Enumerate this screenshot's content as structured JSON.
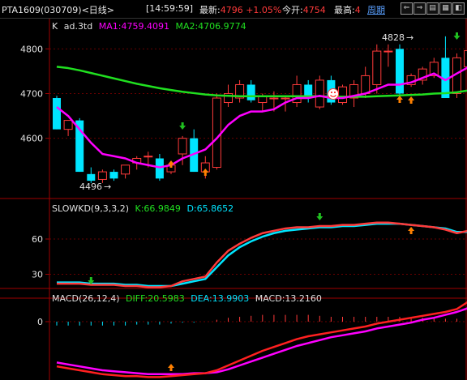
{
  "topbar": {
    "code": "PTA1609(030709)",
    "period": "<日线>",
    "time": "[14:59:59]",
    "latest_label": "最新:",
    "latest_value": "4796",
    "change": "+1.05%",
    "open_label": "今开:",
    "open_value": "4754",
    "high_label": "最高:",
    "high_value": "4",
    "week_link": "周期",
    "buttons": [
      "⇐",
      "⇒",
      "▤",
      "▦",
      "◧"
    ]
  },
  "main_panel": {
    "title_k": "K",
    "title_ad": "ad.3td",
    "ma1_label": "MA1:4759.4091",
    "ma2_label": "MA2:4706.9774",
    "y_ticks": [
      "4800",
      "4700",
      "4600"
    ],
    "low_annotation": "4496",
    "high_annotation": "4828"
  },
  "kd_panel": {
    "title": "SLOWKD(9,3,3,2)",
    "k_label": "K:66.9849",
    "d_label": "D:65.8652",
    "y_ticks": [
      "60",
      "30"
    ]
  },
  "macd_panel": {
    "title": "MACD(26,12,4)",
    "diff_label": "DIFF:20.5983",
    "dea_label": "DEA:13.9903",
    "macd_label": "MACD:13.2160",
    "y_ticks": [
      "0"
    ]
  },
  "colors": {
    "up": "#ff3a3a",
    "down": "#00e5ff",
    "ma1": "#ff00ff",
    "ma2": "#20e020",
    "grid": "#6a0000",
    "axis": "#a00000",
    "diff": "#ff2020",
    "dea": "#ff00ff"
  },
  "chart_data": {
    "type": "candlestick",
    "price_axis": {
      "ylim": [
        4478,
        4835
      ],
      "ticks": [
        4800,
        4700,
        4600
      ]
    },
    "candles": [
      {
        "o": 4690,
        "h": 4695,
        "l": 4620,
        "c": 4620
      },
      {
        "o": 4620,
        "h": 4640,
        "l": 4605,
        "c": 4640
      },
      {
        "o": 4640,
        "h": 4645,
        "l": 4525,
        "c": 4525
      },
      {
        "o": 4520,
        "h": 4535,
        "l": 4500,
        "c": 4505
      },
      {
        "o": 4508,
        "h": 4530,
        "l": 4500,
        "c": 4525
      },
      {
        "o": 4525,
        "h": 4530,
        "l": 4505,
        "c": 4510
      },
      {
        "o": 4520,
        "h": 4540,
        "l": 4510,
        "c": 4540
      },
      {
        "o": 4545,
        "h": 4560,
        "l": 4530,
        "c": 4555
      },
      {
        "o": 4560,
        "h": 4570,
        "l": 4535,
        "c": 4560
      },
      {
        "o": 4555,
        "h": 4565,
        "l": 4505,
        "c": 4510
      },
      {
        "o": 4525,
        "h": 4545,
        "l": 4520,
        "c": 4540
      },
      {
        "o": 4565,
        "h": 4605,
        "l": 4540,
        "c": 4600
      },
      {
        "o": 4600,
        "h": 4620,
        "l": 4525,
        "c": 4525
      },
      {
        "o": 4525,
        "h": 4560,
        "l": 4510,
        "c": 4545
      },
      {
        "o": 4535,
        "h": 4700,
        "l": 4530,
        "c": 4690
      },
      {
        "o": 4680,
        "h": 4720,
        "l": 4670,
        "c": 4700
      },
      {
        "o": 4690,
        "h": 4730,
        "l": 4680,
        "c": 4720
      },
      {
        "o": 4720,
        "h": 4730,
        "l": 4680,
        "c": 4685
      },
      {
        "o": 4680,
        "h": 4700,
        "l": 4660,
        "c": 4695
      },
      {
        "o": 4690,
        "h": 4705,
        "l": 4660,
        "c": 4690
      },
      {
        "o": 4690,
        "h": 4695,
        "l": 4660,
        "c": 4690
      },
      {
        "o": 4680,
        "h": 4740,
        "l": 4670,
        "c": 4720
      },
      {
        "o": 4720,
        "h": 4730,
        "l": 4680,
        "c": 4690
      },
      {
        "o": 4670,
        "h": 4740,
        "l": 4665,
        "c": 4730
      },
      {
        "o": 4730,
        "h": 4740,
        "l": 4675,
        "c": 4680
      },
      {
        "o": 4680,
        "h": 4720,
        "l": 4675,
        "c": 4715
      },
      {
        "o": 4690,
        "h": 4730,
        "l": 4670,
        "c": 4720
      },
      {
        "o": 4700,
        "h": 4760,
        "l": 4690,
        "c": 4740
      },
      {
        "o": 4720,
        "h": 4810,
        "l": 4700,
        "c": 4795
      },
      {
        "o": 4795,
        "h": 4810,
        "l": 4760,
        "c": 4795
      },
      {
        "o": 4800,
        "h": 4810,
        "l": 4690,
        "c": 4700
      },
      {
        "o": 4720,
        "h": 4745,
        "l": 4715,
        "c": 4740
      },
      {
        "o": 4730,
        "h": 4760,
        "l": 4720,
        "c": 4755
      },
      {
        "o": 4740,
        "h": 4780,
        "l": 4735,
        "c": 4770
      },
      {
        "o": 4780,
        "h": 4828,
        "l": 4690,
        "c": 4690
      },
      {
        "o": 4700,
        "h": 4790,
        "l": 4690,
        "c": 4780
      },
      {
        "o": 4760,
        "h": 4800,
        "l": 4740,
        "c": 4796
      }
    ],
    "ma1": [
      4670,
      4650,
      4620,
      4590,
      4565,
      4560,
      4555,
      4545,
      4540,
      4535,
      4540,
      4555,
      4565,
      4575,
      4600,
      4630,
      4650,
      4660,
      4660,
      4665,
      4680,
      4690,
      4690,
      4695,
      4690,
      4690,
      4695,
      4700,
      4710,
      4720,
      4720,
      4725,
      4735,
      4745,
      4730,
      4745,
      4759
    ],
    "ma2": [
      4760,
      4757,
      4752,
      4746,
      4740,
      4734,
      4728,
      4722,
      4717,
      4712,
      4708,
      4704,
      4701,
      4698,
      4696,
      4695,
      4694,
      4694,
      4694,
      4694,
      4694,
      4694,
      4694,
      4694,
      4693,
      4693,
      4693,
      4693,
      4694,
      4695,
      4696,
      4697,
      4698,
      4700,
      4701,
      4703,
      4707
    ],
    "kd_axis": {
      "ylim": [
        20,
        80
      ],
      "ticks": [
        60,
        30
      ]
    },
    "k": [
      22,
      22,
      22,
      21,
      21,
      21,
      20,
      20,
      19,
      19,
      20,
      24,
      26,
      28,
      40,
      50,
      56,
      61,
      65,
      67,
      69,
      70,
      70,
      71,
      71,
      72,
      72,
      73,
      74,
      74,
      73,
      72,
      71,
      70,
      68,
      65,
      67
    ],
    "d": [
      23,
      23,
      23,
      22,
      22,
      22,
      21,
      21,
      20,
      20,
      20,
      22,
      24,
      26,
      36,
      46,
      53,
      58,
      62,
      65,
      67,
      68,
      69,
      70,
      70,
      71,
      71,
      72,
      73,
      73,
      73,
      72,
      71,
      70,
      69,
      66,
      66
    ],
    "macd_axis": {
      "ylim": [
        -60,
        20
      ],
      "ticks": [
        0
      ]
    },
    "diff": [
      -46,
      -48,
      -50,
      -52,
      -54,
      -55,
      -56,
      -56,
      -57,
      -57,
      -56,
      -55,
      -54,
      -53,
      -50,
      -45,
      -40,
      -35,
      -30,
      -26,
      -22,
      -18,
      -15,
      -13,
      -11,
      -9,
      -7,
      -5,
      -2,
      0,
      2,
      4,
      6,
      8,
      10,
      13,
      20.6
    ],
    "dea": [
      -42,
      -44,
      -46,
      -48,
      -50,
      -51,
      -52,
      -53,
      -54,
      -54,
      -54,
      -54,
      -53,
      -53,
      -52,
      -49,
      -45,
      -41,
      -37,
      -33,
      -29,
      -25,
      -22,
      -19,
      -16,
      -14,
      -12,
      -10,
      -7,
      -5,
      -3,
      -1,
      2,
      4,
      7,
      10,
      14
    ],
    "macd_hist": [
      -4,
      -4,
      -4,
      -4,
      -4,
      -4,
      -4,
      -3,
      -3,
      -3,
      -2,
      -1,
      -1,
      0,
      2,
      4,
      5,
      6,
      7,
      7,
      7,
      7,
      7,
      6,
      5,
      5,
      5,
      5,
      5,
      5,
      5,
      5,
      4,
      4,
      3,
      3,
      13.2
    ]
  }
}
